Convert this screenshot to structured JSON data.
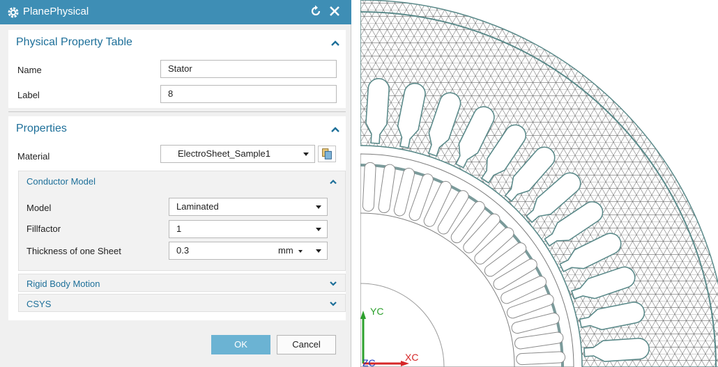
{
  "dialog": {
    "title": "PlanePhysical",
    "title_icon": "gear-icon",
    "reset_icon": "reset-icon",
    "close_icon": "close-icon",
    "physical_property_table": {
      "heading": "Physical Property Table",
      "name_label": "Name",
      "name_value": "Stator",
      "label_label": "Label",
      "label_value": "8"
    },
    "properties": {
      "heading": "Properties",
      "material_label": "Material",
      "material_value": "ElectroSheet_Sample1",
      "material_browse_icon": "material-library-icon",
      "conductor_model": {
        "heading": "Conductor Model",
        "model_label": "Model",
        "model_value": "Laminated",
        "fillfactor_label": "Fillfactor",
        "fillfactor_value": "1",
        "thickness_label": "Thickness of one Sheet",
        "thickness_value": "0.3",
        "thickness_unit": "mm"
      },
      "rigid_body_motion": "Rigid Body Motion",
      "csys": "CSYS"
    },
    "buttons": {
      "ok": "OK",
      "cancel": "Cancel"
    },
    "colors": {
      "title_bar": "#3e8eb5",
      "section_heading": "#1d6f99",
      "ok_button": "#6bb3d3"
    }
  },
  "viewport": {
    "axis_labels": {
      "y": "YC",
      "x": "XC",
      "z": "ZC"
    },
    "colors": {
      "mesh_line": "#4a4a4a",
      "outline": "#5b8a8a",
      "axis_y": "#2ca02c",
      "axis_x": "#d62728",
      "axis_z": "#1f3fbf"
    }
  }
}
